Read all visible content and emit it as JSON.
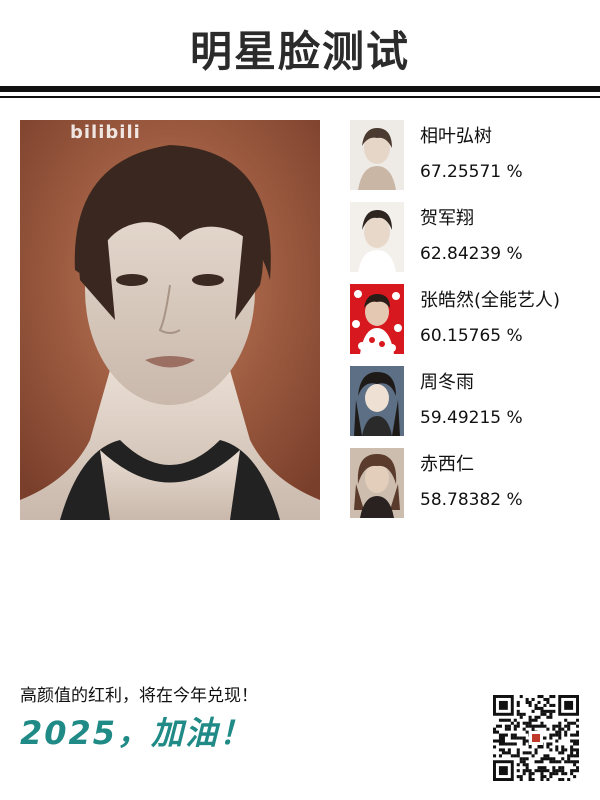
{
  "title": "明星脸测试",
  "main_photo": {
    "watermark": "bilibili"
  },
  "results": [
    {
      "name": "相叶弘树",
      "score": "67.25571 %"
    },
    {
      "name": "贺军翔",
      "score": "62.84239 %"
    },
    {
      "name": "张皓然(全能艺人)",
      "score": "60.15765 %"
    },
    {
      "name": "周冬雨",
      "score": "59.49215 %"
    },
    {
      "name": "赤西仁",
      "score": "58.78382 %"
    }
  ],
  "footer": {
    "line": "高颜值的红利，将在今年兑现！",
    "slogan": "2025，加油！"
  },
  "colors": {
    "accent": "#1f8a86",
    "rule": "#111111"
  },
  "icons": {
    "qr": "qr-code-icon"
  }
}
